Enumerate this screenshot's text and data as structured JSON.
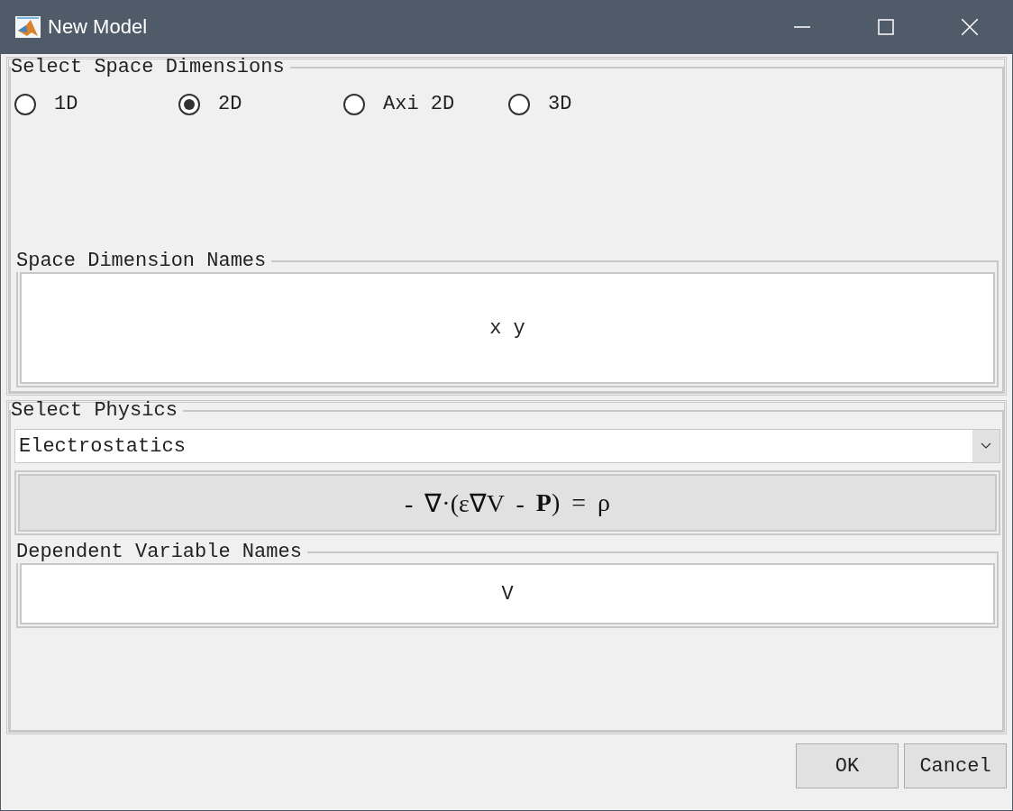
{
  "window": {
    "title": "New Model"
  },
  "space_dimensions": {
    "title": "Select Space Dimensions",
    "options": [
      {
        "label": "1D",
        "selected": false
      },
      {
        "label": "2D",
        "selected": true
      },
      {
        "label": "Axi 2D",
        "selected": false
      },
      {
        "label": "3D",
        "selected": false
      }
    ]
  },
  "space_dimension_names": {
    "title": "Space Dimension Names",
    "value": "x y"
  },
  "physics": {
    "title": "Select Physics",
    "value": "Electrostatics",
    "equation": "- ∇·(ε∇V - **P**) = ρ"
  },
  "dependent_variable_names": {
    "title": "Dependent Variable Names",
    "value": "V"
  },
  "buttons": [
    "OK",
    "Cancel"
  ]
}
